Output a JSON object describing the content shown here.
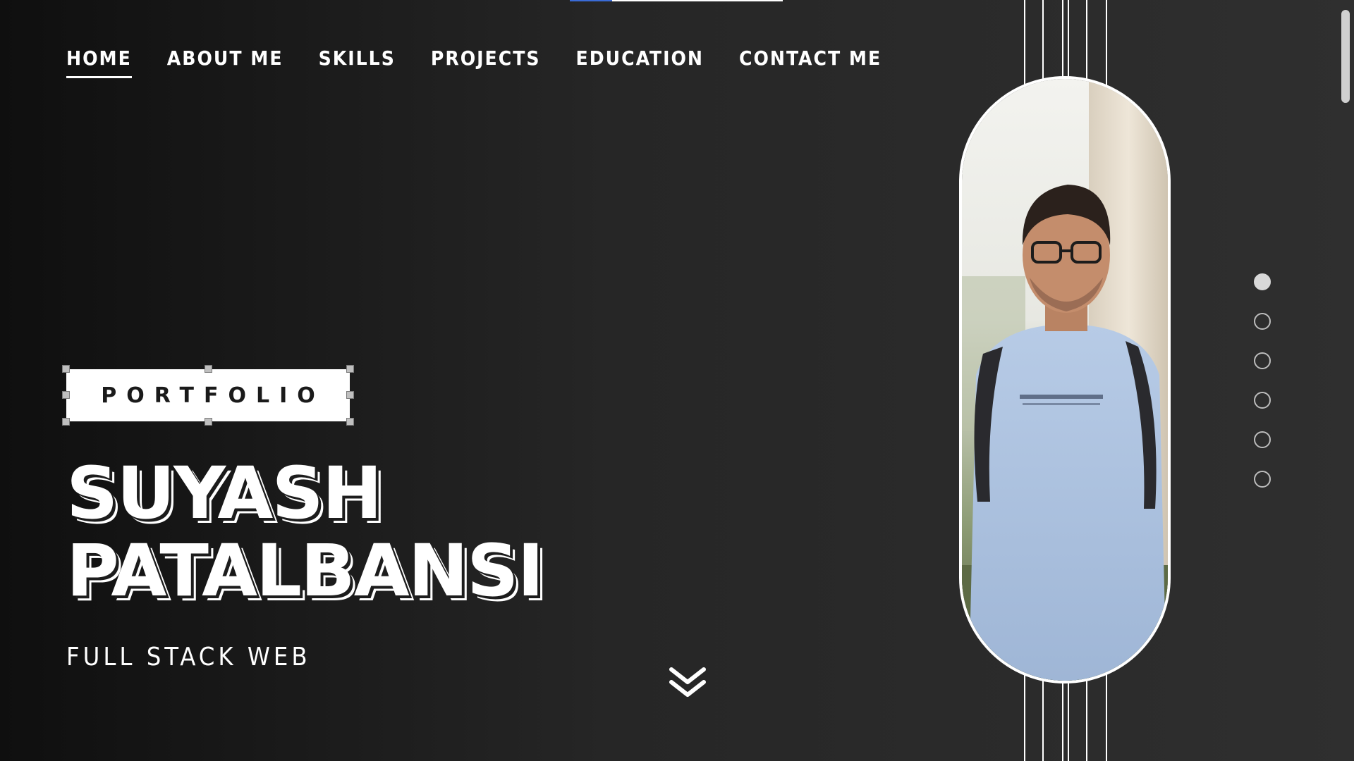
{
  "nav": {
    "items": [
      {
        "label": "HOME",
        "active": true
      },
      {
        "label": "ABOUT ME",
        "active": false
      },
      {
        "label": "SKILLS",
        "active": false
      },
      {
        "label": "PROJECTS",
        "active": false
      },
      {
        "label": "EDUCATION",
        "active": false
      },
      {
        "label": "CONTACT ME",
        "active": false
      }
    ]
  },
  "hero": {
    "badge": "PORTFOLIO",
    "name_line1": "SUYASH",
    "name_line2": "PATALBANSI",
    "subtitle": "FULL STACK WEB"
  },
  "scroll_down_icon": "double-chevron-down-icon",
  "section_dots": {
    "count": 6,
    "active_index": 0
  },
  "top_progress": {
    "fraction": 0.2
  },
  "colors": {
    "background_dark": "#0f0f0f",
    "background_light": "#2f2f2f",
    "text": "#ffffff",
    "progress_accent": "#3a6bd6"
  }
}
